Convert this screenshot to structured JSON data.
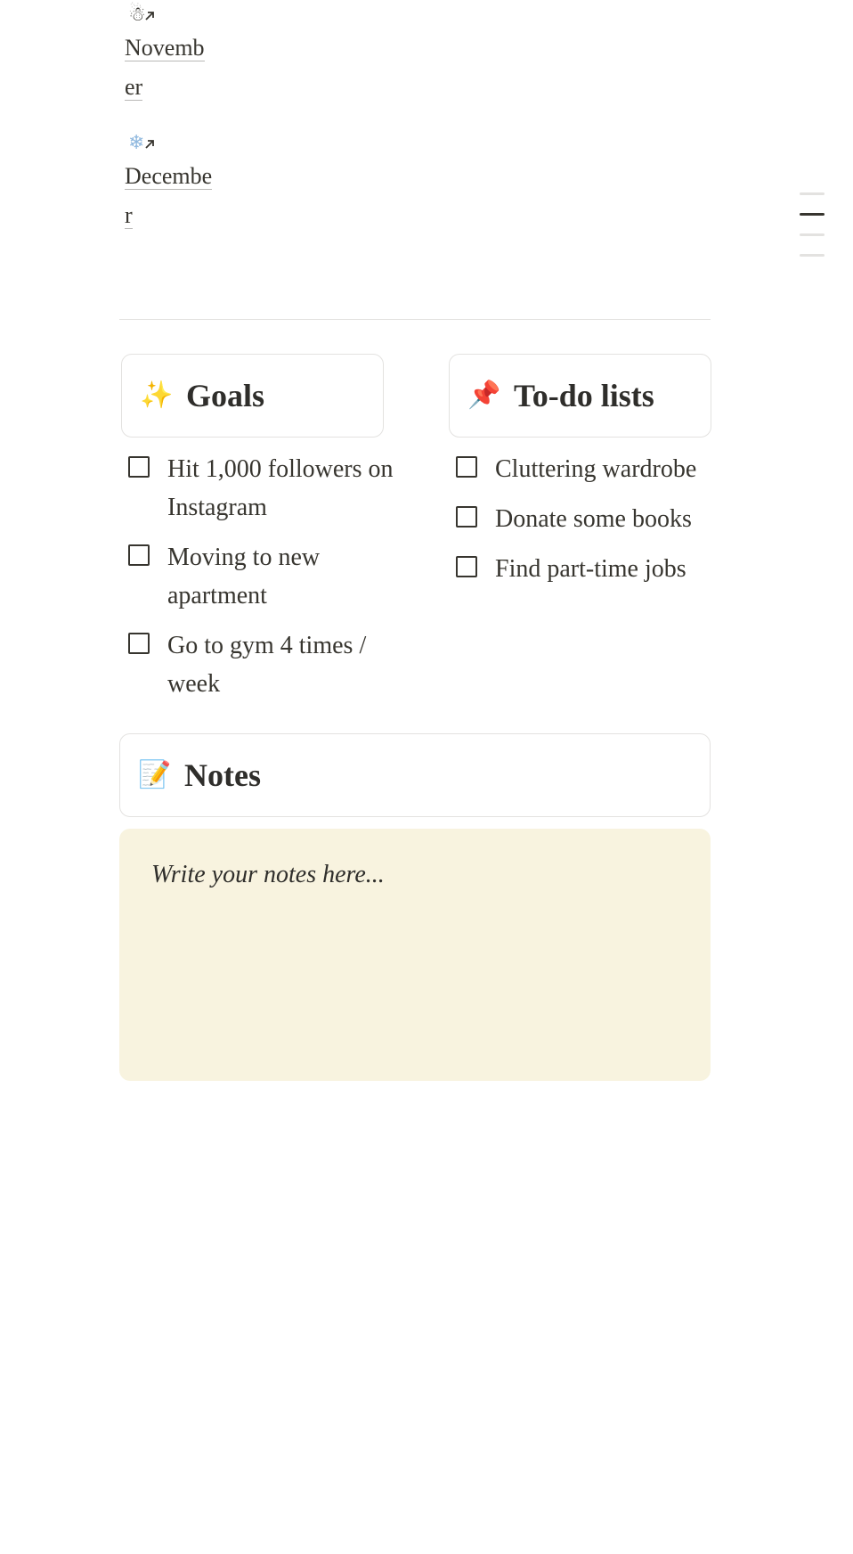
{
  "months": [
    {
      "name": "November",
      "emoji": "☃",
      "icon": "snowman-icon"
    },
    {
      "name": "December",
      "emoji": "❄",
      "icon": "snowflake-icon"
    }
  ],
  "goals": {
    "icon": "sparkles-icon",
    "emoji": "✨",
    "title": "Goals",
    "items": [
      "Hit 1,000 followers on Instagram",
      "Moving to new apartment",
      "Go to gym 4 times / week"
    ]
  },
  "todo": {
    "icon": "pushpin-icon",
    "emoji": "📌",
    "title": "To-do lists",
    "items": [
      "Cluttering wardrobe",
      "Donate some books",
      "Find part-time jobs"
    ]
  },
  "notes": {
    "icon": "memo-icon",
    "emoji": "📝",
    "title": "Notes",
    "placeholder": "Write your notes here..."
  },
  "colors": {
    "text": "#37352f",
    "border": "#e3e2e0",
    "notes_background": "#f8f3df",
    "toc_active": "#37352f",
    "toc_inactive": "#e3e2e0"
  }
}
